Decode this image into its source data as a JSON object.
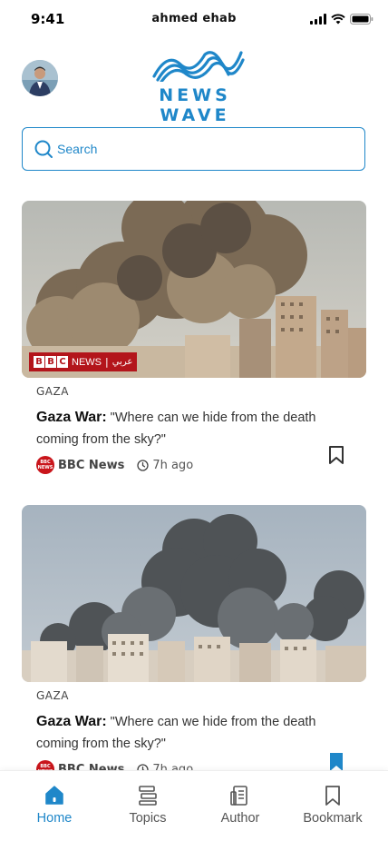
{
  "status_bar": {
    "time": "9:41",
    "user_name": "ahmed ehab"
  },
  "header": {
    "logo_text": "NEWS WAVE"
  },
  "search": {
    "placeholder": "Search"
  },
  "articles": [
    {
      "category": "GAZA",
      "headline_bold": "Gaza War:",
      "headline_rest": " \"Where can we hide from the death coming from the sky?\"",
      "source": "BBC News",
      "source_logo": "BBC NEWS",
      "time_ago": "7h ago",
      "bookmarked": false,
      "image_overlay": {
        "brand": "BBC",
        "channel": "NEWS",
        "language": "عربي"
      }
    },
    {
      "category": "GAZA",
      "headline_bold": "Gaza War:",
      "headline_rest": " \"Where can we hide from the death coming from the sky?\"",
      "source": "BBC News",
      "source_logo": "BBC NEWS",
      "time_ago": "7h ago",
      "bookmarked": true
    }
  ],
  "bottom_nav": {
    "items": [
      {
        "label": "Home",
        "icon": "home-icon",
        "active": true
      },
      {
        "label": "Topics",
        "icon": "topics-icon",
        "active": false
      },
      {
        "label": "Author",
        "icon": "author-icon",
        "active": false
      },
      {
        "label": "Bookmark",
        "icon": "bookmark-icon",
        "active": false
      }
    ]
  },
  "colors": {
    "accent": "#1f87c9",
    "bbc_red": "#c9151b"
  }
}
